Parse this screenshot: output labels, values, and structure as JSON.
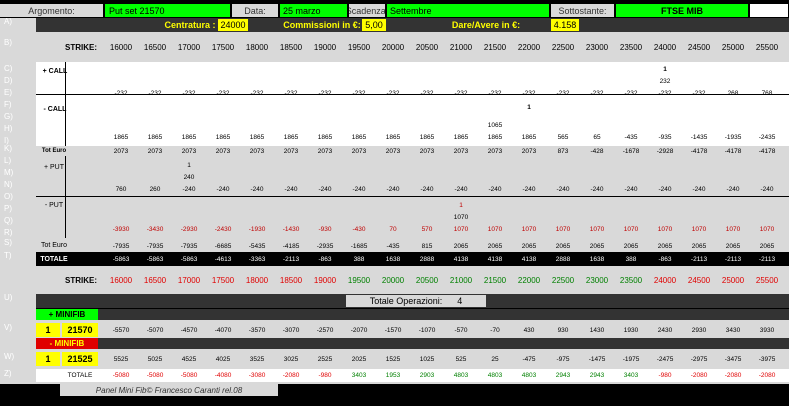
{
  "header": {
    "argomento_label": "Argomento:",
    "argomento_value": "Put set 21570",
    "data_label": "Data:",
    "data_value": "25 marzo",
    "scadenza_label": "Scadenza:",
    "scadenza_value": "Settembre",
    "sottostante_label": "Sottostante:",
    "sottostante_value": "FTSE MIB",
    "centratura_label": "Centratura :",
    "centratura_value": "24000",
    "commissioni_label": "Commissioni in €:",
    "commissioni_value": "5,00",
    "dare_label": "Dare/Avere in €:",
    "dare_value": "4.158"
  },
  "row_letters": [
    "A)",
    "B)",
    "C)",
    "D)",
    "E)",
    "F)",
    "G)",
    "H)",
    "I)",
    "K)",
    "L)",
    "M)",
    "N)",
    "O)",
    "P)",
    "Q)",
    "R)",
    "S)",
    "T)",
    "U)",
    "V)",
    "W)",
    "Z)"
  ],
  "strike_label": "STRIKE:",
  "strikes": [
    "16000",
    "16500",
    "17000",
    "17500",
    "18000",
    "18500",
    "19000",
    "19500",
    "20000",
    "20500",
    "21000",
    "21500",
    "22000",
    "22500",
    "23000",
    "23500",
    "24000",
    "24500",
    "25000",
    "25500"
  ],
  "labels": {
    "call_plus": "+ CALL",
    "call_minus": "- CALL",
    "tot_euro_call": "Tot Euro",
    "put_plus": "+ PUT",
    "put_minus": "- PUT",
    "tot_euro": "Tot Euro",
    "totale": "TOTALE",
    "totale_operazioni_label": "Totale Operazioni:",
    "totale_operazioni_value": "4",
    "minifib_plus": "+ MINIFIB",
    "minifib_minus": "- MINIFIB",
    "totale_bottom": "TOTALE",
    "footer": "Panel Mini Fib©  Francesco Caranti  rel.08"
  },
  "call_plus_markers": {
    "qty": "1",
    "price": "232",
    "col": 16
  },
  "row_e": [
    "-232",
    "-232",
    "-232",
    "-232",
    "-232",
    "-232",
    "-232",
    "-232",
    "-232",
    "-232",
    "-232",
    "-232",
    "-232",
    "-232",
    "-232",
    "-232",
    "-232",
    "-232",
    "268",
    "768"
  ],
  "call_minus_marker": {
    "qty": "1",
    "col": 12
  },
  "row_h_extra": {
    "value": "1065",
    "col": 11
  },
  "row_i": [
    "1865",
    "1865",
    "1865",
    "1865",
    "1865",
    "1865",
    "1865",
    "1865",
    "1865",
    "1865",
    "1865",
    "1865",
    "1865",
    "565",
    "65",
    "-435",
    "-935",
    "-1435",
    "-1935",
    "-2435"
  ],
  "row_k": [
    "2073",
    "2073",
    "2073",
    "2073",
    "2073",
    "2073",
    "2073",
    "2073",
    "2073",
    "2073",
    "2073",
    "2073",
    "2073",
    "873",
    "-428",
    "-1678",
    "-2928",
    "-4178",
    "-4178",
    "-4178"
  ],
  "put_plus_markers": {
    "qty": "1",
    "price": "240",
    "col": 2
  },
  "row_n": [
    "760",
    "260",
    "-240",
    "-240",
    "-240",
    "-240",
    "-240",
    "-240",
    "-240",
    "-240",
    "-240",
    "-240",
    "-240",
    "-240",
    "-240",
    "-240",
    "-240",
    "-240",
    "-240",
    "-240"
  ],
  "put_minus_marker": {
    "qty": "1",
    "price": "1070",
    "col": 10
  },
  "row_r": [
    "-3930",
    "-3430",
    "-2930",
    "-2430",
    "-1930",
    "-1430",
    "-930",
    "-430",
    "70",
    "570",
    "1070",
    "1070",
    "1070",
    "1070",
    "1070",
    "1070",
    "1070",
    "1070",
    "1070",
    "1070"
  ],
  "row_s": [
    "-7935",
    "-7935",
    "-7935",
    "-6685",
    "-5435",
    "-4185",
    "-2935",
    "-1685",
    "-435",
    "815",
    "2065",
    "2065",
    "2065",
    "2065",
    "2065",
    "2065",
    "2065",
    "2065",
    "2065",
    "2065"
  ],
  "row_t": [
    "-5863",
    "-5863",
    "-5863",
    "-4613",
    "-3363",
    "-2113",
    "-863",
    "388",
    "1638",
    "2888",
    "4138",
    "4138",
    "4138",
    "2888",
    "1638",
    "388",
    "-863",
    "-2113",
    "-2113",
    "-2113"
  ],
  "strike_colors": [
    "red",
    "red",
    "red",
    "red",
    "red",
    "red",
    "red",
    "grn",
    "grn",
    "grn",
    "grn",
    "grn",
    "grn",
    "grn",
    "grn",
    "grn",
    "red",
    "red",
    "red",
    "red"
  ],
  "minifib": {
    "v_qty": "1",
    "v_price": "21570",
    "w_qty": "1",
    "w_price": "21525"
  },
  "row_v": [
    "-5570",
    "-5070",
    "-4570",
    "-4070",
    "-3570",
    "-3070",
    "-2570",
    "-2070",
    "-1570",
    "-1070",
    "-570",
    "-70",
    "430",
    "930",
    "1430",
    "1930",
    "2430",
    "2930",
    "3430",
    "3930"
  ],
  "row_w": [
    "5525",
    "5025",
    "4525",
    "4025",
    "3525",
    "3025",
    "2525",
    "2025",
    "1525",
    "1025",
    "525",
    "25",
    "-475",
    "-975",
    "-1475",
    "-1975",
    "-2475",
    "-2975",
    "-3475",
    "-3975"
  ],
  "row_z": [
    "-5080",
    "-5080",
    "-5080",
    "-4080",
    "-3080",
    "-2080",
    "-980",
    "3403",
    "1953",
    "2903",
    "4803",
    "4803",
    "4803",
    "2943",
    "2943",
    "3403",
    "-980",
    "-2080",
    "-2080",
    "-2080"
  ],
  "row_z_colors": [
    "red",
    "red",
    "red",
    "red",
    "red",
    "red",
    "red",
    "grn",
    "grn",
    "grn",
    "grn",
    "grn",
    "grn",
    "grn",
    "grn",
    "grn",
    "red",
    "red",
    "red",
    "red"
  ],
  "colors": {
    "green": "#00ff00",
    "yellow": "#ffff00",
    "grey": "#d9d9d9",
    "dark": "#333333"
  }
}
